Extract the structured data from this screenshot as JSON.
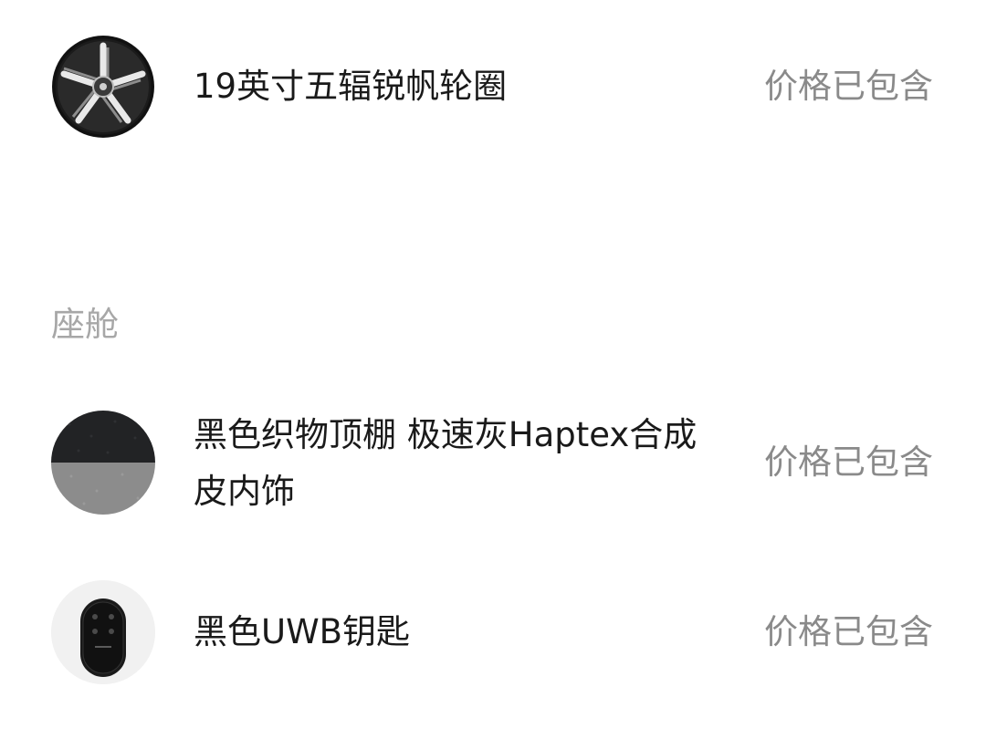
{
  "options_top": [
    {
      "name": "19英寸五辐锐帆轮圈",
      "price": "价格已包含",
      "icon": "wheel-rim-icon"
    }
  ],
  "cabin_section": {
    "title": "座舱",
    "items": [
      {
        "name": "黑色织物顶棚 极速灰Haptex合成皮内饰",
        "price": "价格已包含",
        "icon": "interior-swatch-icon"
      },
      {
        "name": "黑色UWB钥匙",
        "price": "价格已包含",
        "icon": "car-key-icon"
      }
    ]
  },
  "colors": {
    "text_primary": "#1a1a1a",
    "text_secondary": "#8a8a8a",
    "section_title": "#a7a7a7",
    "background": "#ffffff"
  }
}
